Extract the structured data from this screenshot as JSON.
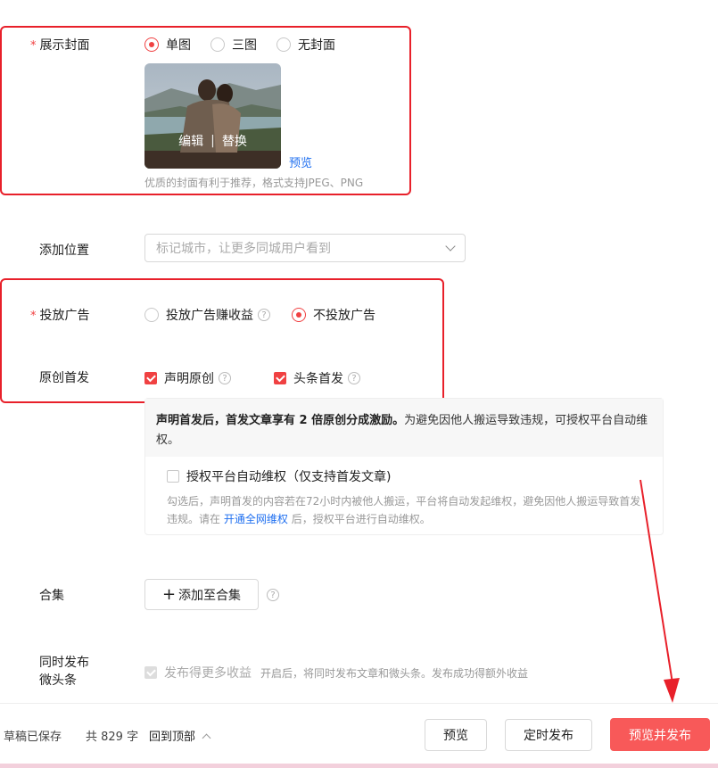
{
  "cover": {
    "label": "展示封面",
    "options": [
      "单图",
      "三图",
      "无封面"
    ],
    "edit": "编辑",
    "replace": "替换",
    "preview": "预览",
    "hint": "优质的封面有利于推荐，格式支持JPEG、PNG"
  },
  "location": {
    "label": "添加位置",
    "placeholder": "标记城市，让更多同城用户看到"
  },
  "ads": {
    "label": "投放广告",
    "option_earn": "投放广告赚收益",
    "option_none": "不投放广告"
  },
  "original": {
    "label": "原创首发",
    "declare": "声明原创",
    "first": "头条首发"
  },
  "panel": {
    "head_bold": "声明首发后，首发文章享有 2 倍原创分成激励。",
    "head_rest": "为避免因他人搬运导致违规，可授权平台自动维权。",
    "check_label": "授权平台自动维权（仅支持首发文章)",
    "desc_1": "勾选后，声明首发的内容若在72小时内被他人搬运，平台将自动发起维权，避免因他人搬运导致首发违规。请在",
    "desc_link": "开通全网维权",
    "desc_2": "后，授权平台进行自动维权。"
  },
  "collection": {
    "label": "合集",
    "add_button": "添加至合集"
  },
  "micro": {
    "label_line1": "同时发布",
    "label_line2": "微头条",
    "check_label": "发布得更多收益",
    "note": "开启后，将同时发布文章和微头条。发布成功得额外收益"
  },
  "footer": {
    "saved": "草稿已保存",
    "count": "共 829 字",
    "back_top": "回到顶部",
    "preview": "预览",
    "schedule": "定时发布",
    "publish": "预览并发布"
  }
}
